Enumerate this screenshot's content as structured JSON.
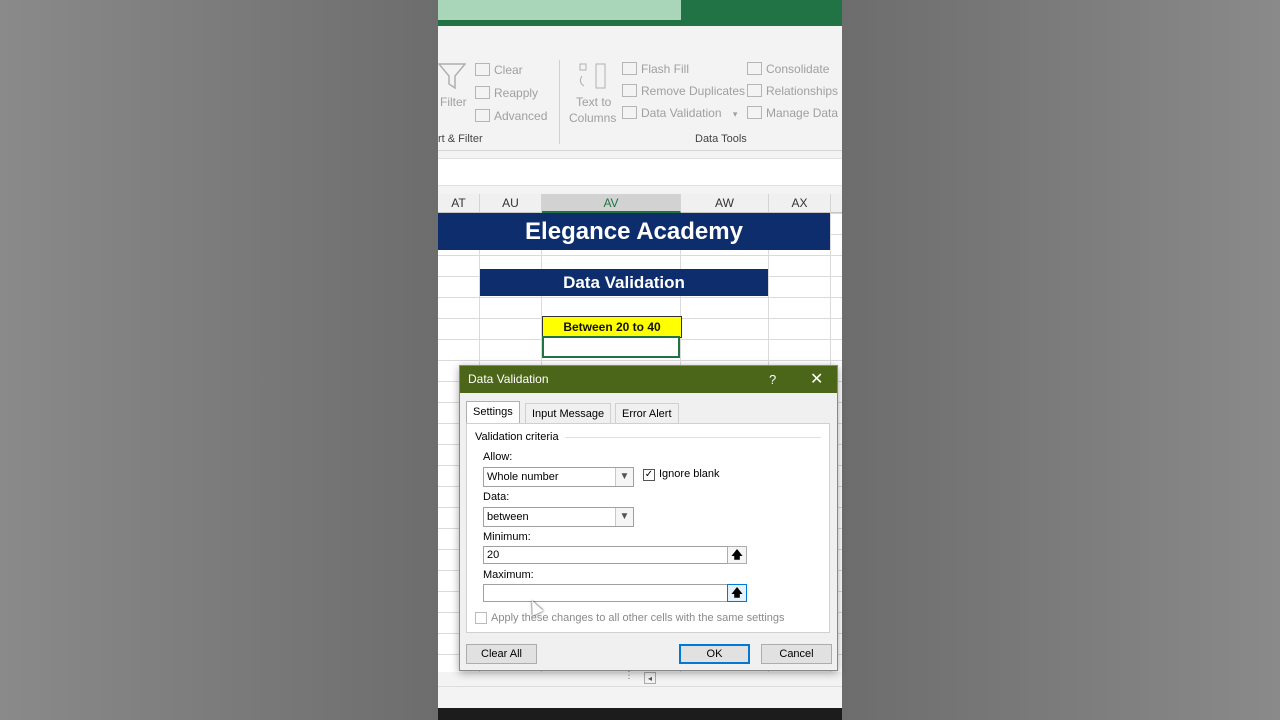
{
  "ribbon": {
    "sort_filter": {
      "filter_label": "Filter",
      "clear_label": "Clear",
      "reapply_label": "Reapply",
      "advanced_label": "Advanced",
      "group_label": "rt & Filter"
    },
    "data_tools": {
      "text_to_columns_line1": "Text to",
      "text_to_columns_line2": "Columns",
      "flash_fill_label": "Flash Fill",
      "remove_duplicates_label": "Remove Duplicates",
      "data_validation_label": "Data Validation",
      "consolidate_label": "Consolidate",
      "relationships_label": "Relationships",
      "manage_data_model_label": "Manage Data M",
      "group_label": "Data Tools"
    }
  },
  "sheet": {
    "columns": [
      "AT",
      "AU",
      "AV",
      "AW",
      "AX"
    ],
    "selected_column": "AV",
    "title_banner": "Elegance Academy",
    "subtitle_banner": "Data Validation",
    "header_cell": "Between 20 to 40",
    "colors": {
      "banner": "#0d2d6c",
      "header_cell": "#ffff00",
      "accent": "#217346"
    }
  },
  "dialog": {
    "title": "Data Validation",
    "help_icon": "?",
    "close_icon": "✕",
    "tabs": [
      "Settings",
      "Input Message",
      "Error Alert"
    ],
    "active_tab": "Settings",
    "validation_criteria_label": "Validation criteria",
    "allow_label": "Allow:",
    "allow_value": "Whole number",
    "ignore_blank_label": "Ignore blank",
    "ignore_blank_checked": true,
    "data_label": "Data:",
    "data_value": "between",
    "minimum_label": "Minimum:",
    "minimum_value": "20",
    "maximum_label": "Maximum:",
    "maximum_value": "",
    "apply_all_label": "Apply these changes to all other cells with the same settings",
    "clear_all_label": "Clear All",
    "ok_label": "OK",
    "cancel_label": "Cancel",
    "title_bar_color": "#4b6519"
  }
}
